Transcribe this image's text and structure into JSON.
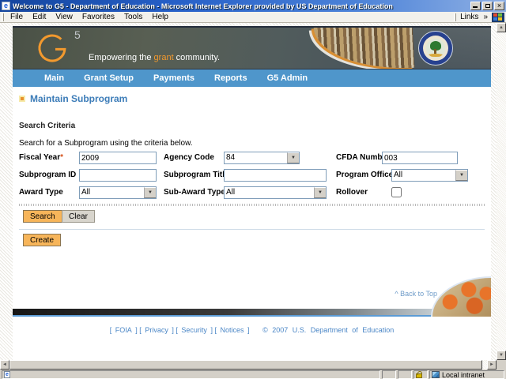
{
  "colors": {
    "accent_orange": "#F2992E",
    "button_orange": "#F7B55A",
    "nav_blue": "#4F96CB",
    "heading_blue": "#3C7CB8",
    "link_blue": "#4A86C6",
    "titlebar_blue": "#2660C8"
  },
  "window": {
    "title": "Welcome to G5 - Department of Education - Microsoft Internet Explorer provided by US Department of Education",
    "close_glyph": "×"
  },
  "menubar": {
    "items": [
      "File",
      "Edit",
      "View",
      "Favorites",
      "Tools",
      "Help"
    ],
    "links_label": "Links",
    "links_chevron": "»"
  },
  "banner": {
    "logo_g": "G",
    "logo_sup": "5",
    "tagline_pre": "Empowering the ",
    "tagline_highlight": "grant",
    "tagline_post": " community."
  },
  "nav": {
    "items": [
      "Main",
      "Grant Setup",
      "Payments",
      "Reports",
      "G5 Admin"
    ]
  },
  "content": {
    "heading": "Maintain Subprogram",
    "section_title": "Search Criteria",
    "instructions": "Search for a Subprogram using the criteria below.",
    "back_to_top": "^ Back to Top"
  },
  "form": {
    "fiscal_year": {
      "label": "Fiscal Year",
      "required_marker": "*",
      "value": "2009"
    },
    "agency_code": {
      "label": "Agency Code",
      "value": "84"
    },
    "cfda_number": {
      "label": "CFDA Number",
      "value": "003"
    },
    "subprogram_id": {
      "label": "Subprogram ID",
      "value": ""
    },
    "subprogram_title": {
      "label": "Subprogram Title",
      "value": ""
    },
    "program_office": {
      "label": "Program Office",
      "value": "All"
    },
    "award_type": {
      "label": "Award Type",
      "value": "All"
    },
    "sub_award_type": {
      "label": "Sub-Award Type",
      "value": "All"
    },
    "rollover": {
      "label": "Rollover",
      "checked": false
    }
  },
  "buttons": {
    "search": "Search",
    "clear": "Clear",
    "create": "Create"
  },
  "footer": {
    "bracket_open": "[",
    "bracket_close": "]",
    "links": [
      "FOIA",
      "Privacy",
      "Security",
      "Notices"
    ],
    "copyright": "© 2007 U.S. Department of Education"
  },
  "statusbar": {
    "zone": "Local intranet"
  },
  "icons": {
    "ie_glyph": "e",
    "dropdown": "▼",
    "scroll_up": "▲",
    "scroll_down": "▼",
    "scroll_left": "◄",
    "scroll_right": "►"
  }
}
